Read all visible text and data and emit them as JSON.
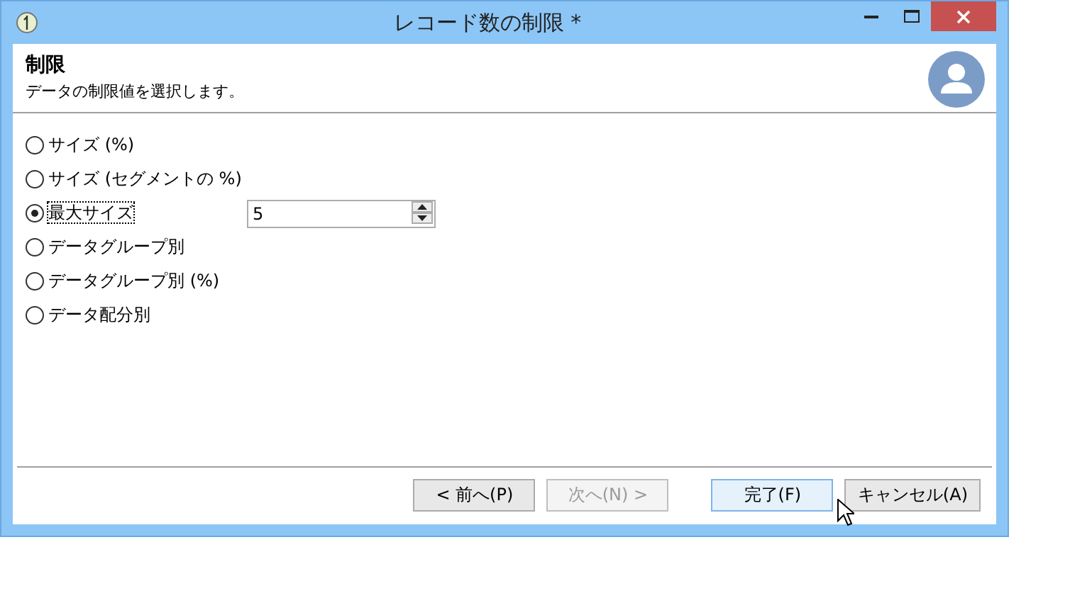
{
  "window": {
    "title": "レコード数の制限 *"
  },
  "header": {
    "title": "制限",
    "subtitle": "データの制限値を選択します。"
  },
  "options": [
    {
      "label": "サイズ (%)",
      "selected": false
    },
    {
      "label": "サイズ (セグメントの %)",
      "selected": false
    },
    {
      "label": "最大サイズ",
      "selected": true,
      "value": "5"
    },
    {
      "label": "データグループ別",
      "selected": false
    },
    {
      "label": "データグループ別 (%)",
      "selected": false
    },
    {
      "label": "データ配分別",
      "selected": false
    }
  ],
  "buttons": [
    {
      "label": "< 前へ(P)",
      "disabled": false,
      "hovered": false
    },
    {
      "label": "次へ(N) >",
      "disabled": true,
      "hovered": false
    },
    {
      "label": "完了(F)",
      "disabled": false,
      "hovered": true
    },
    {
      "label": "キャンセル(A)",
      "disabled": false,
      "hovered": false
    }
  ]
}
